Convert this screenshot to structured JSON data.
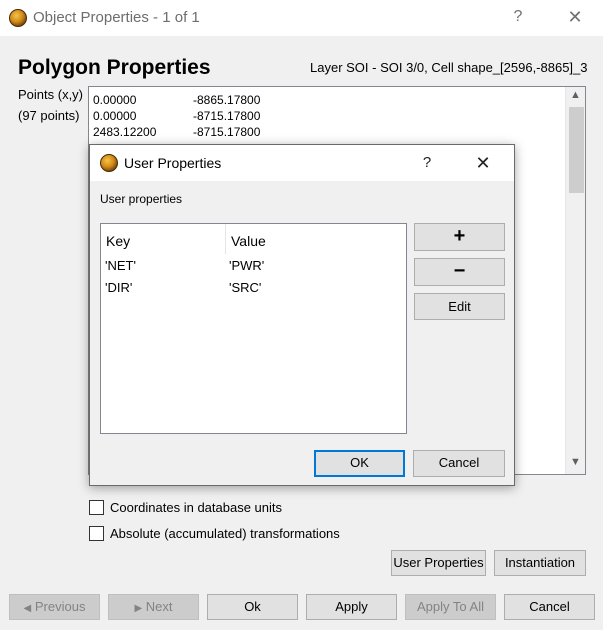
{
  "window": {
    "title": "Object Properties - 1 of 1",
    "help_label": "?",
    "close_label": "✕"
  },
  "main": {
    "heading": "Polygon Properties",
    "layer_info": "Layer SOI - SOI 3/0, Cell shape_[2596,-8865]_3",
    "points_label": "Points (x,y)",
    "points_count": "(97 points)",
    "points_rows": [
      {
        "x": "0.00000",
        "y": "-8865.17800"
      },
      {
        "x": "0.00000",
        "y": "-8715.17800"
      },
      {
        "x": "2483.12200",
        "y": "-8715.17800"
      }
    ],
    "checkboxes": [
      {
        "label": "Coordinates in database units",
        "checked": false
      },
      {
        "label": "Absolute (accumulated) transformations",
        "checked": false
      }
    ],
    "user_properties_button": "User Properties",
    "instantiation_button": "Instantiation"
  },
  "footer": {
    "previous": "Previous",
    "next": "Next",
    "ok": "Ok",
    "apply": "Apply",
    "apply_to_all": "Apply To All",
    "cancel": "Cancel"
  },
  "dialog": {
    "title": "User Properties",
    "help_label": "?",
    "close_label": "✕",
    "section_label": "User properties",
    "columns": [
      "Key",
      "Value"
    ],
    "rows": [
      {
        "key": "'NET'",
        "value": "'PWR'"
      },
      {
        "key": "'DIR'",
        "value": "'SRC'"
      }
    ],
    "add_label": "+",
    "remove_label": "−",
    "edit_label": "Edit",
    "ok_label": "OK",
    "cancel_label": "Cancel"
  },
  "colors": {
    "accent": "#0078d7",
    "window_bg": "#f0f0f0",
    "disabled_text": "#838383"
  }
}
